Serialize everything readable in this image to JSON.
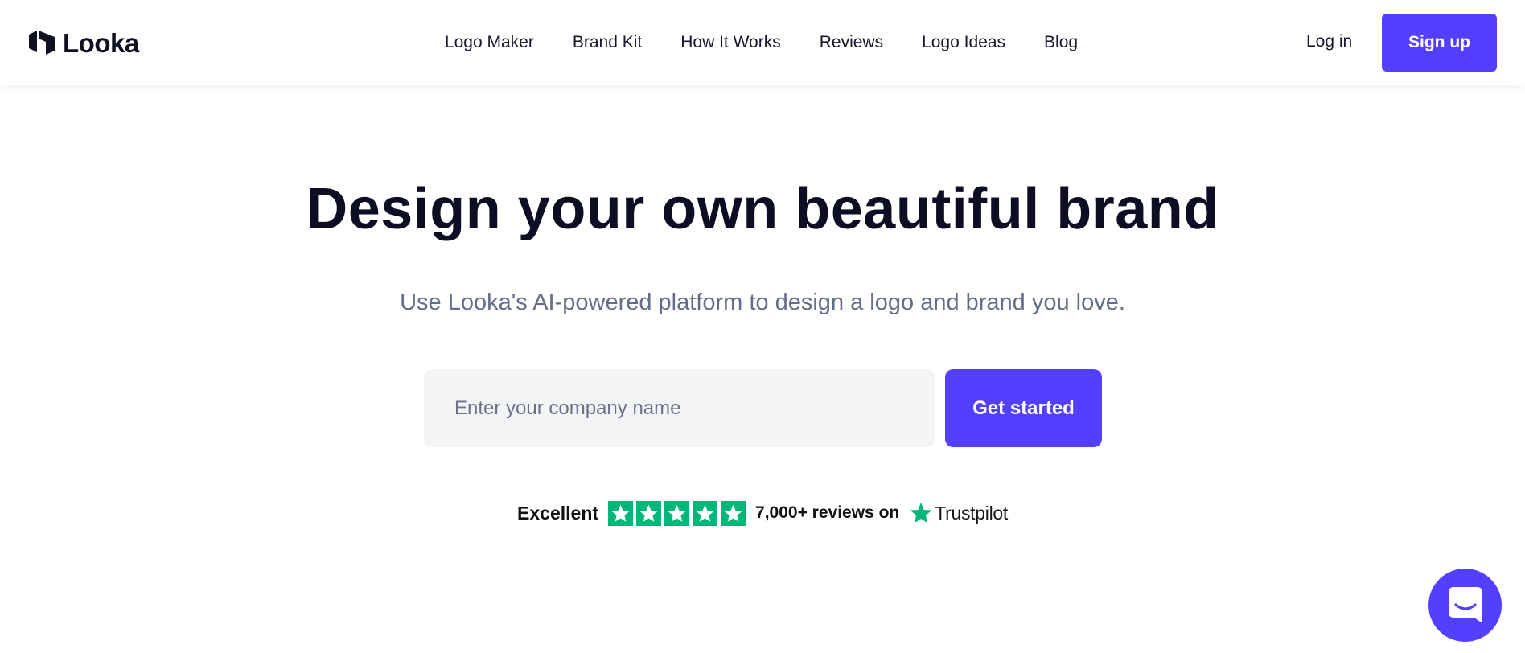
{
  "header": {
    "brand_name": "Looka",
    "brand_icon": "looka-logo-icon",
    "nav": [
      {
        "label": "Logo Maker"
      },
      {
        "label": "Brand Kit"
      },
      {
        "label": "How It Works"
      },
      {
        "label": "Reviews"
      },
      {
        "label": "Logo Ideas"
      },
      {
        "label": "Blog"
      }
    ],
    "login_label": "Log in",
    "signup_label": "Sign up"
  },
  "hero": {
    "title": "Design your own beautiful brand",
    "subtitle": "Use Looka's AI-powered platform to design a logo and brand you love.",
    "input_placeholder": "Enter your company name",
    "input_value": "",
    "cta_label": "Get started"
  },
  "trust": {
    "rating_text": "Excellent",
    "stars": 5,
    "star_icon": "star-icon",
    "reviews_text": "7,000+ reviews on",
    "brand": "Trustpilot"
  },
  "chat": {
    "icon": "chat-icon"
  },
  "colors": {
    "accent": "#5340FF",
    "trustpilot_green": "#00B67A",
    "heading": "#0D0E24",
    "subtext": "#666D88",
    "input_bg": "#F3F4F6"
  }
}
